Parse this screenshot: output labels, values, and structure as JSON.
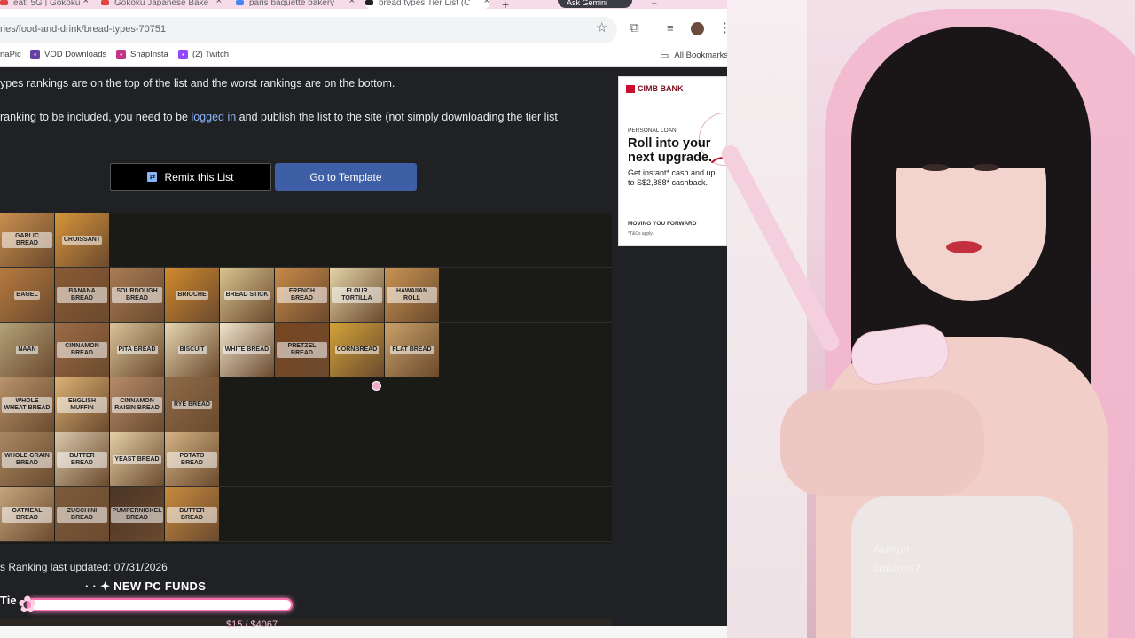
{
  "browser": {
    "tabs": [
      {
        "title": "eat! 5G | Gokoku",
        "color": "#e0443e",
        "active": false
      },
      {
        "title": "Gokoku Japanese Bake",
        "color": "#e0443e",
        "active": false
      },
      {
        "title": "paris baguette bakery",
        "color": "#4285f4",
        "active": false
      },
      {
        "title": "bread types Tier List (C",
        "color": "#222222",
        "active": true
      }
    ],
    "new_tab_glyph": "+",
    "gemini_label": "Ask Gemini",
    "window_controls": "–□✕",
    "url": "ries/food-and-drink/bread-types-70751",
    "toolbar_icons": {
      "star": "☆",
      "extensions": "⧉",
      "menu": "⋮"
    },
    "bookmarks": [
      {
        "label": "naPic",
        "icon_color": "#ffffff",
        "icon_glyph": ""
      },
      {
        "label": "VOD Downloads",
        "icon_color": "#6441a5",
        "icon_glyph": "▪"
      },
      {
        "label": "SnapInsta",
        "icon_color": "#c13584",
        "icon_glyph": "▪"
      },
      {
        "label": "(2) Twitch",
        "icon_color": "#9146ff",
        "icon_glyph": "▪"
      }
    ],
    "all_bookmarks_label": "All Bookmarks",
    "all_bookmarks_icon": "▭"
  },
  "page": {
    "intro_line": "ypes rankings are on the top of the list and the worst rankings are on the bottom.",
    "login_prefix": "ranking to be included, you need to be ",
    "login_link": "logged in",
    "login_suffix": " and publish the list to the site (not simply downloading the tier list",
    "remix_label": "Remix this List",
    "remix_icon_glyph": "⇄",
    "template_label": "Go to Template",
    "last_updated": "s Ranking last updated: 07/31/2026",
    "tier_heading": "Tie"
  },
  "tiers": [
    {
      "items": [
        {
          "label": "Garlic Bread",
          "color": "#c98f4e"
        },
        {
          "label": "Croissant",
          "color": "#d7953a"
        }
      ]
    },
    {
      "items": [
        {
          "label": "Bagel",
          "color": "#b77a3f"
        },
        {
          "label": "Banana Bread",
          "color": "#8a5a34"
        },
        {
          "label": "Sourdough Bread",
          "color": "#a87c55"
        },
        {
          "label": "Brioche",
          "color": "#d28a2c"
        },
        {
          "label": "Bread Stick",
          "color": "#d8c48f"
        },
        {
          "label": "French Bread",
          "color": "#c88a47"
        },
        {
          "label": "Flour Tortilla",
          "color": "#e4d4a8"
        },
        {
          "label": "Hawaiian Roll",
          "color": "#c99452"
        }
      ]
    },
    {
      "items": [
        {
          "label": "Naan",
          "color": "#b3a27a"
        },
        {
          "label": "Cinnamon Bread",
          "color": "#9c6b46"
        },
        {
          "label": "Pita Bread",
          "color": "#d9c49a"
        },
        {
          "label": "Biscuit",
          "color": "#e6d6b0"
        },
        {
          "label": "White Bread",
          "color": "#f1e6cf"
        },
        {
          "label": "Pretzel Bread",
          "color": "#7a4520"
        },
        {
          "label": "Cornbread",
          "color": "#d3a338"
        },
        {
          "label": "Flat Bread",
          "color": "#c9a168"
        }
      ]
    },
    {
      "items": [
        {
          "label": "Whole Wheat Bread",
          "color": "#b8936b"
        },
        {
          "label": "English Muffin",
          "color": "#dbb173"
        },
        {
          "label": "Cinnamon Raisin Bread",
          "color": "#b58b6a"
        },
        {
          "label": "Rye Bread",
          "color": "#8e6a48"
        }
      ]
    },
    {
      "items": [
        {
          "label": "Whole Grain Bread",
          "color": "#a88863"
        },
        {
          "label": "Butter Bread",
          "color": "#d9c7aa"
        },
        {
          "label": "Yeast Bread",
          "color": "#e3cfa5"
        },
        {
          "label": "Potato Bread",
          "color": "#d4b283"
        }
      ]
    },
    {
      "items": [
        {
          "label": "Oatmeal Bread",
          "color": "#c4a47c"
        },
        {
          "label": "Zucchini Bread",
          "color": "#7d5a3b"
        },
        {
          "label": "Pumpernickel Bread",
          "color": "#4a3426"
        },
        {
          "label": "Butter Bread",
          "color": "#c78a3e"
        }
      ]
    }
  ],
  "ad": {
    "brand": "CIMB BANK",
    "subtitle": "PERSONAL LOAN",
    "headline": "Roll into your next upgrade.",
    "body": "Get instant* cash and up to S$2,888* cashback.",
    "footer": "MOVING YOU FORWARD",
    "terms": "*T&Cs apply."
  },
  "stream_overlay": {
    "funds_title": "· · ✦  NEW PC FUNDS",
    "funds_amount": "$15 / $4067",
    "funds_progress": 0.0037,
    "funds_flower": "✿",
    "chat_ghost_lines": [
      "Akimprl_",
      "croutons?"
    ]
  },
  "colors": {
    "accent_pink": "#ff8cc3",
    "template_blue": "#3e5fa6",
    "link_blue": "#8ab4f8",
    "page_bg": "#202124"
  }
}
